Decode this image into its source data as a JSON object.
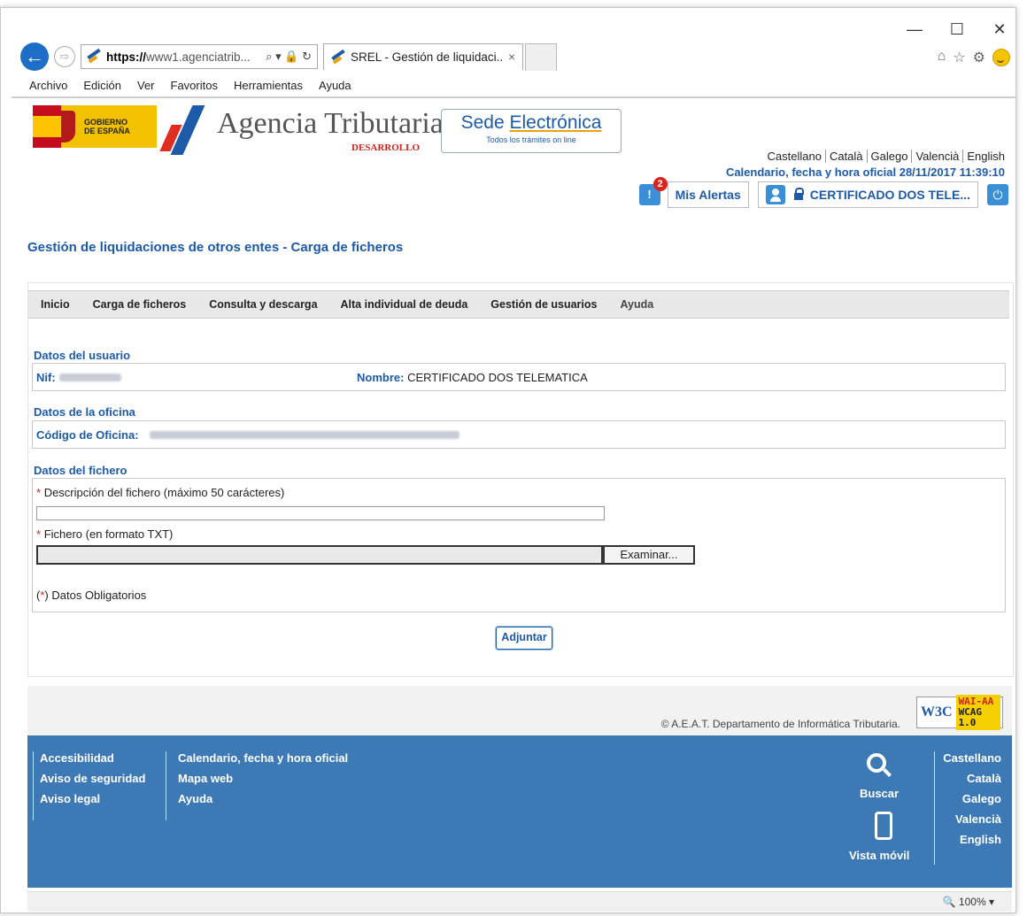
{
  "browser": {
    "url_host": "https://",
    "url_rest": "www1.agenciatrib...",
    "url_tools": "⌕ ▾ 🔒 ↻",
    "tab_title": "SREL - Gestión de liquidaci...",
    "tab_close": "×",
    "minimize": "—",
    "maximize": "☐",
    "close": "✕",
    "menu": [
      "Archivo",
      "Edición",
      "Ver",
      "Favoritos",
      "Herramientas",
      "Ayuda"
    ]
  },
  "header": {
    "gobierno": "GOBIERNO",
    "espana": "DE ESPAÑA",
    "agency": "Agencia Tributaria",
    "environment": "DESARROLLO",
    "sede_title_1": "Sede ",
    "sede_title_2": "Electrónica",
    "sede_sub": "Todos los trámites on line",
    "languages": [
      "Castellano",
      "Català",
      "Galego",
      "Valencià",
      "English"
    ],
    "calendar": "Calendario, fecha y hora oficial 28/11/2017 11:39:10",
    "alerts_count": "2",
    "alerts_label": "Mis Alertas",
    "user_label": "CERTIFICADO DOS TELE..."
  },
  "page": {
    "title": "Gestión de liquidaciones de otros entes - Carga de ficheros",
    "nav": [
      "Inicio",
      "Carga de ficheros",
      "Consulta y descarga",
      "Alta individual de deuda",
      "Gestión de usuarios",
      "Ayuda"
    ],
    "user_section": "Datos del usuario",
    "nif_label": "Nif:",
    "nombre_label": "Nombre:",
    "nombre_value": "CERTIFICADO DOS TELEMATICA",
    "office_section": "Datos de la oficina",
    "office_label": "Código de Oficina:",
    "file_section": "Datos del fichero",
    "desc_label": "Descripción del fichero (máximo 50 carácteres)",
    "file_label": "Fichero (en formato TXT)",
    "browse_button": "Examinar...",
    "required_note": "Datos Obligatorios",
    "required_mark": "*",
    "submit": "Adjuntar"
  },
  "footer": {
    "copyright": "© A.E.A.T. Departamento de Informática Tributaria.",
    "w3c": "W3C",
    "wai": "WAI-AA",
    "wcag": "WCAG 1.0",
    "col1": [
      "Accesibilidad",
      "Aviso de seguridad",
      "Aviso legal"
    ],
    "col2": [
      "Calendario, fecha y hora oficial",
      "Mapa web",
      "Ayuda"
    ],
    "buscar": "Buscar",
    "vista_movil": "Vista móvil",
    "languages": [
      "Castellano",
      "Català",
      "Galego",
      "Valencià",
      "English"
    ]
  },
  "status": {
    "zoom": "100%"
  }
}
